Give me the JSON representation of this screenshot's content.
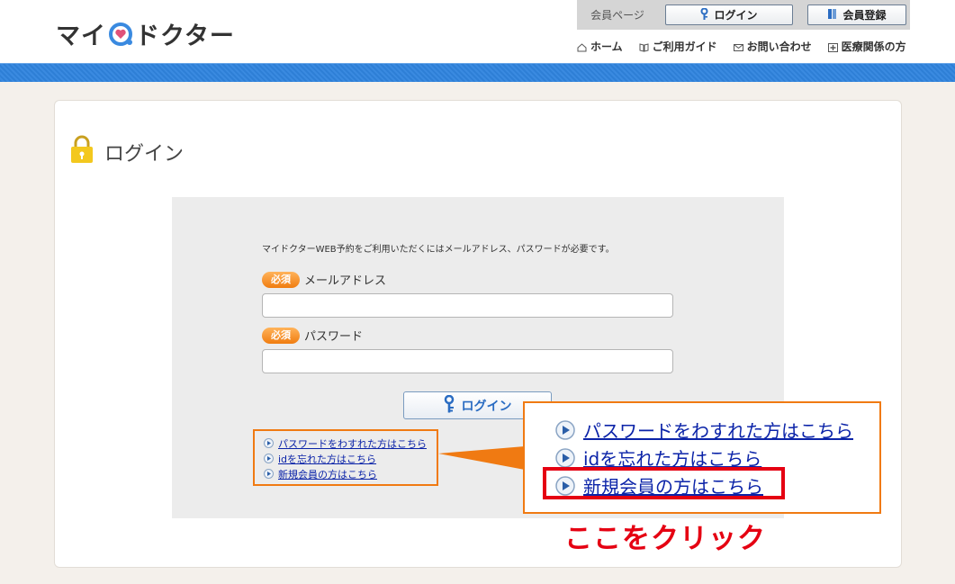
{
  "header": {
    "logo_text_1": "マイ",
    "logo_text_2": "ドクター",
    "logo_icon": "stethoscope-heart-icon",
    "member_tab": "会員ページ",
    "login_button": "ログイン",
    "register_button": "会員登録",
    "nav": [
      {
        "label": "ホーム",
        "icon": "home-icon"
      },
      {
        "label": "ご利用ガイド",
        "icon": "book-icon"
      },
      {
        "label": "お問い合わせ",
        "icon": "mail-icon"
      },
      {
        "label": "医療関係の方",
        "icon": "plus-box-icon"
      }
    ]
  },
  "page": {
    "title": "ログイン",
    "title_icon": "padlock-icon"
  },
  "form": {
    "intro": "マイドクターWEB予約をご利用いただくにはメールアドレス、パスワードが必要です。",
    "required_badge": "必須",
    "email_label": "メールアドレス",
    "email_value": "",
    "password_label": "パスワード",
    "password_value": "",
    "submit_label": "ログイン"
  },
  "links": [
    "パスワードをわすれた方はこちら",
    "idを忘れた方はこちら",
    "新規会員の方はこちら"
  ],
  "annotation": {
    "callout": "ここをクリック",
    "highlight_color": "#e50012",
    "box_color": "#f07a12"
  },
  "colors": {
    "brand_blue": "#2e7fd6",
    "link": "#0b23a8",
    "badge_orange": "#f07c10",
    "page_bg": "#f4f0eb"
  }
}
